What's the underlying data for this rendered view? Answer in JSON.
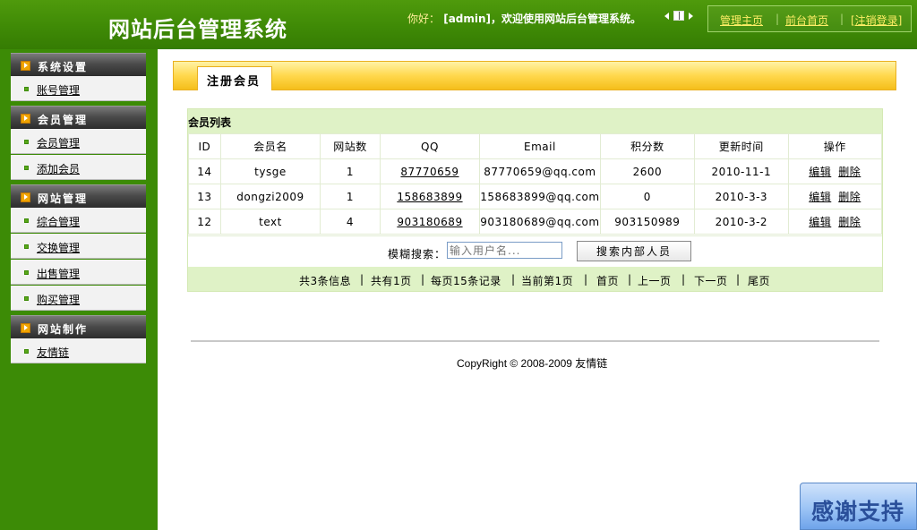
{
  "header": {
    "site_title": "网站后台管理系统",
    "welcome_prefix": "你好：",
    "welcome_text": "[admin]，欢迎使用网站后台管理系统。",
    "links": [
      "管理主页",
      "前台首页",
      "[注销登录]"
    ],
    "separator": "|"
  },
  "sidebar": {
    "sections": [
      {
        "title": "系统设置",
        "items": [
          "账号管理"
        ]
      },
      {
        "title": "会员管理",
        "items": [
          "会员管理",
          "添加会员"
        ]
      },
      {
        "title": "网站管理",
        "items": [
          "综合管理",
          "交换管理",
          "出售管理",
          "购买管理"
        ]
      },
      {
        "title": "网站制作",
        "items": [
          "友情链"
        ]
      }
    ]
  },
  "main": {
    "tab_label": "注册会员",
    "list_caption": "会员列表",
    "columns": [
      "ID",
      "会员名",
      "网站数",
      "QQ",
      "Email",
      "积分数",
      "更新时间",
      "操作"
    ],
    "rows": [
      {
        "id": "14",
        "name": "tysge",
        "sites": "1",
        "qq": "87770659",
        "email": "87770659@qq.com",
        "points": "2600",
        "updated": "2010-11-1"
      },
      {
        "id": "13",
        "name": "dongzi2009",
        "sites": "1",
        "qq": "158683899",
        "email": "158683899@qq.com",
        "points": "0",
        "updated": "2010-3-3"
      },
      {
        "id": "12",
        "name": "text",
        "sites": "4",
        "qq": "903180689",
        "email": "903180689@qq.com",
        "points": "903150989",
        "updated": "2010-3-2"
      }
    ],
    "actions": {
      "edit": "编辑",
      "delete": "删除"
    },
    "search": {
      "label": "模糊搜索：",
      "placeholder": "输入用户名...",
      "button": "搜索内部人员"
    },
    "pager": {
      "total_info": "共3条信息",
      "pages_info": "共有1页",
      "per_page": "每页15条记录",
      "current": "当前第1页",
      "first": "首页",
      "prev": "上一页",
      "next": "下一页",
      "last": "尾页",
      "separator": "|"
    }
  },
  "footer": {
    "copyright": "CopyRight © 2008-2009 友情链"
  },
  "badge": {
    "thanks": "感谢支持"
  },
  "colors": {
    "header_green": "#3f8a06",
    "sidebar_green": "#3c8b06",
    "tab_yellow": "#ffd84d",
    "table_green": "#dff2c6",
    "link_yellow": "#ffee66"
  }
}
